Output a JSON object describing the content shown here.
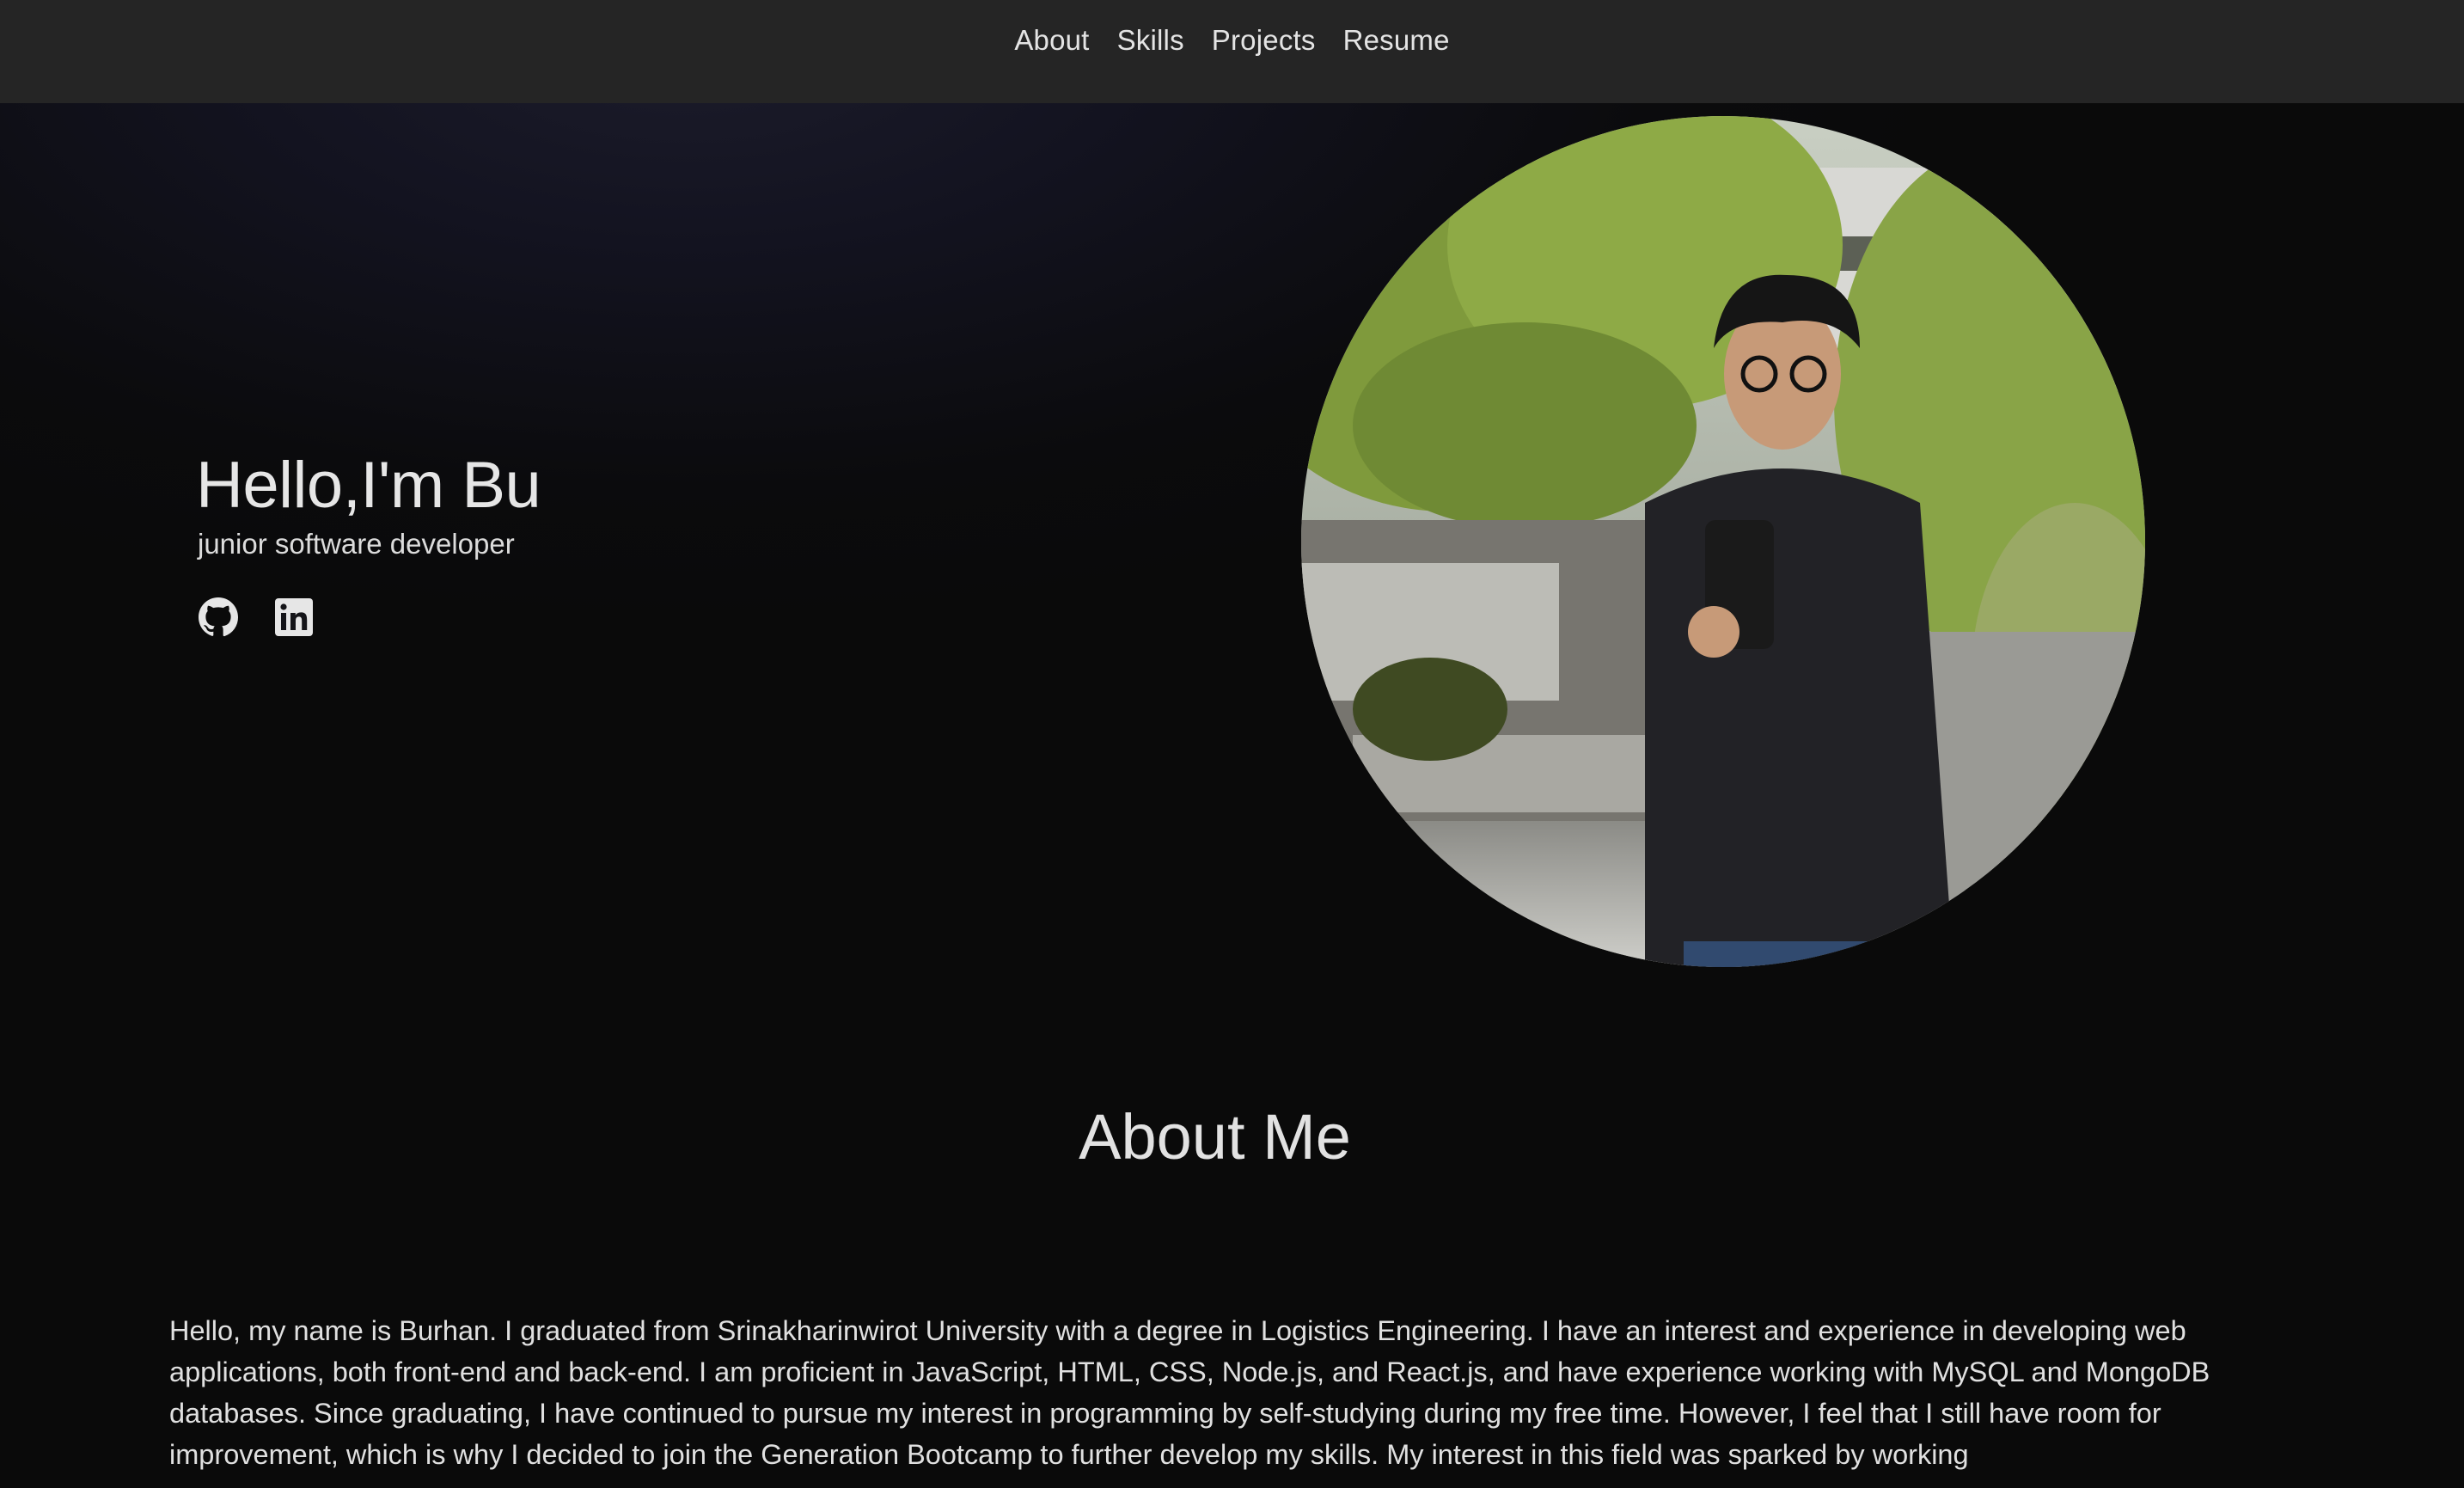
{
  "nav": {
    "links": [
      "About",
      "Skills",
      "Projects",
      "Resume"
    ]
  },
  "hero": {
    "title": "Hello,I'm Bu",
    "subtitle": "junior software developer",
    "social": [
      {
        "icon": "github-icon"
      },
      {
        "icon": "linkedin-icon"
      }
    ]
  },
  "about": {
    "heading": "About Me",
    "text": "Hello, my name is Burhan. I graduated from Srinakharinwirot University with a degree in Logistics Engineering. I have an interest and experience in developing web applications, both front-end and back-end. I am proficient in JavaScript, HTML, CSS, Node.js, and React.js, and have experience working with MySQL and MongoDB databases. Since graduating, I have continued to pursue my interest in programming by self-studying during my free time. However, I feel that I still have room for improvement, which is why I decided to join the Generation Bootcamp to further develop my skills. My interest in this field was sparked by working"
  },
  "colors": {
    "navbar_bg": "#252525",
    "page_bg": "#0b0b0c",
    "text": "#e0e0e0"
  }
}
